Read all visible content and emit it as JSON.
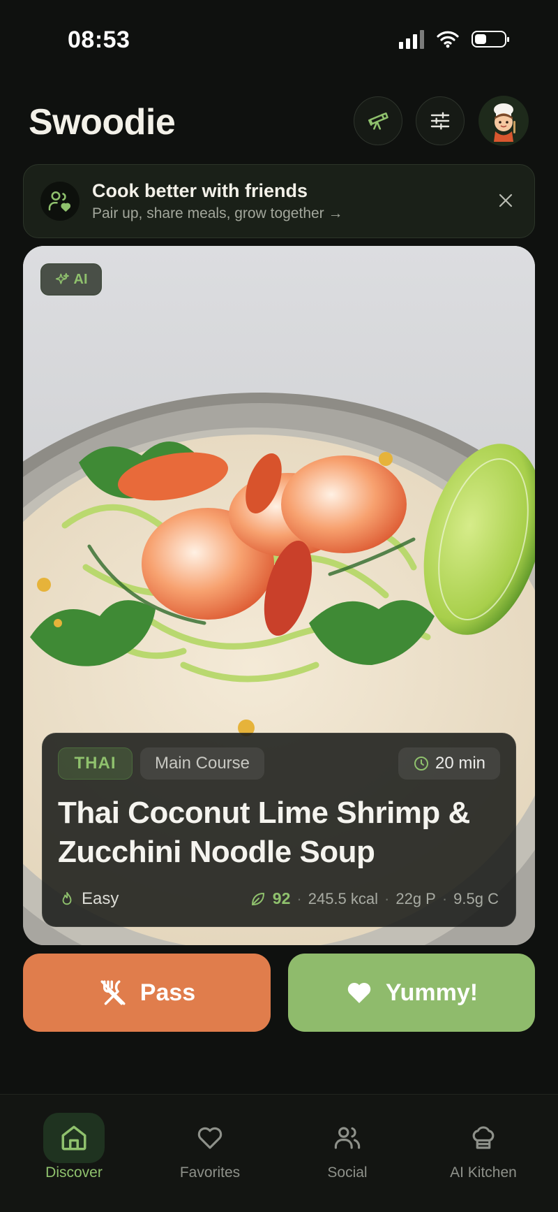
{
  "status": {
    "time": "08:53"
  },
  "header": {
    "title": "Swoodie",
    "explore_icon": "telescope-icon",
    "filter_icon": "sliders-icon",
    "avatar_icon": "chef-avatar"
  },
  "banner": {
    "title": "Cook better with friends",
    "subtitle": "Pair up, share meals, grow together →",
    "icon": "friends-heart-icon"
  },
  "recipe": {
    "badge": "AI",
    "cuisine": "THAI",
    "course": "Main Course",
    "time": "20 min",
    "title": "Thai Coconut Lime Shrimp & Zucchini Noodle Soup",
    "difficulty": "Easy",
    "score": "92",
    "calories": "245.5 kcal",
    "protein": "22g P",
    "carbs": "9.5g C"
  },
  "actions": {
    "pass": "Pass",
    "yummy": "Yummy!"
  },
  "nav": [
    {
      "label": "Discover",
      "icon": "home-icon",
      "active": true
    },
    {
      "label": "Favorites",
      "icon": "heart-icon",
      "active": false
    },
    {
      "label": "Social",
      "icon": "users-icon",
      "active": false
    },
    {
      "label": "AI Kitchen",
      "icon": "chef-hat-icon",
      "active": false
    }
  ],
  "colors": {
    "accent": "#8fc16d",
    "pass": "#e07d4c",
    "yummy": "#8fbb6c",
    "background": "#0f110f"
  }
}
